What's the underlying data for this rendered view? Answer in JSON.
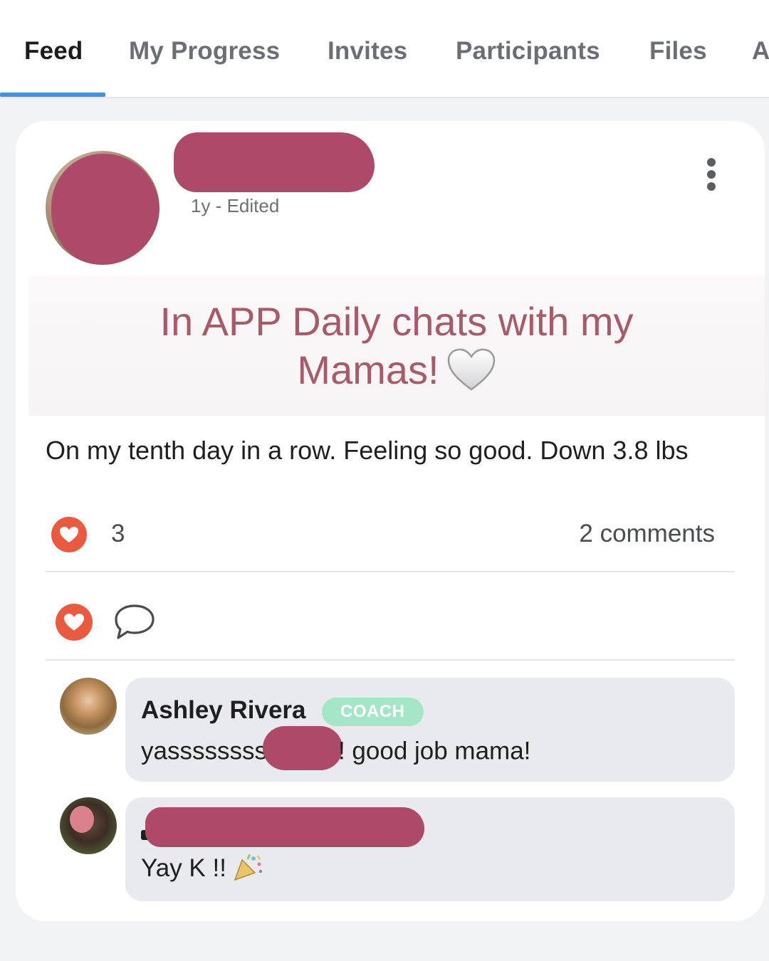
{
  "tabs": [
    {
      "label": "Feed",
      "active": true
    },
    {
      "label": "My Progress",
      "active": false
    },
    {
      "label": "Invites",
      "active": false
    },
    {
      "label": "Participants",
      "active": false
    },
    {
      "label": "Files",
      "active": false
    },
    {
      "label": "A",
      "active": false
    }
  ],
  "post": {
    "meta": "1y - Edited",
    "banner_line1": "In APP Daily chats with my",
    "banner_line2": "Mamas!",
    "body": "On my tenth day in a row. Feeling so good. Down 3.8 lbs",
    "like_count": "3",
    "comments_count": "2 comments"
  },
  "comments": [
    {
      "author": "Ashley Rivera",
      "badge": "COACH",
      "text_before": "yassssssss",
      "text_after": "! good job mama!"
    },
    {
      "text": "Yay K !!"
    }
  ],
  "colors": {
    "accent_tab": "#4a8fd8",
    "heart": "#ea5a3e",
    "banner_text": "#a85a68",
    "redaction": "#ad4a6a",
    "coach_badge": "#a6e6c8"
  },
  "icons": {
    "more": "kebab-vertical-icon",
    "like": "heart-icon",
    "comment": "speech-bubble-icon",
    "white_heart": "white-heart-emoji",
    "party": "party-popper-emoji"
  }
}
